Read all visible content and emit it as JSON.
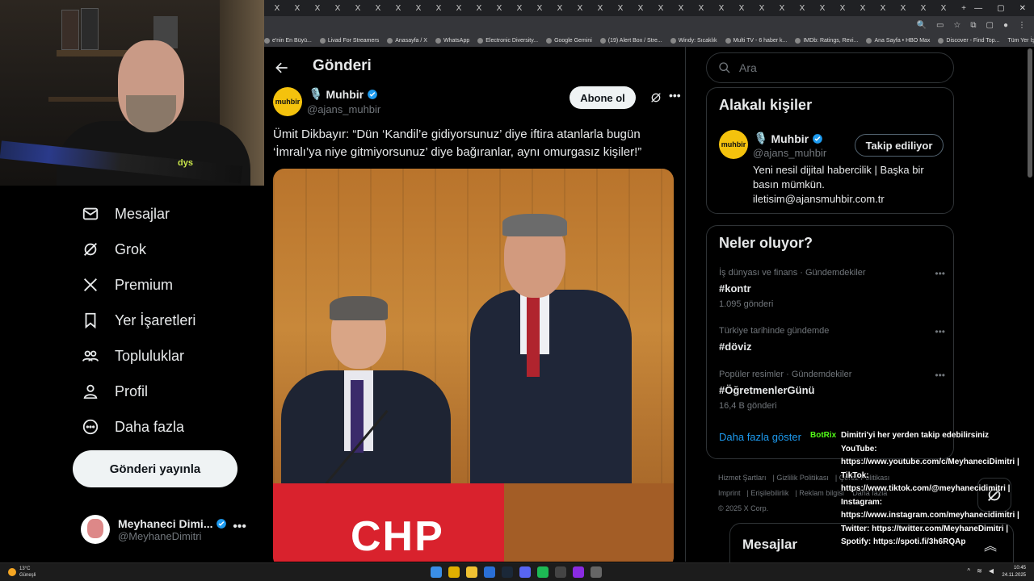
{
  "browser": {
    "tab_glyph": "X",
    "tab_count": 34,
    "new_tab": "+",
    "bookmarks": [
      "e'nin En Büyü...",
      "Livad For Streamers",
      "Anasayfa / X",
      "WhatsApp",
      "Electronic Diversity...",
      "Google Gemini",
      "(19) Alert Box / Stre...",
      "Windy: Sıcaklık",
      "Multi TV - 6 haber k...",
      "IMDb: Ratings, Revi...",
      "Ana Sayfa • HBO Max",
      "Discover - Find Top..."
    ],
    "all_bookmarks": "Tüm Yer İşaretleri"
  },
  "nav": {
    "items": [
      {
        "label": "Mesajlar",
        "icon": "mail-icon"
      },
      {
        "label": "Grok",
        "icon": "grok-icon"
      },
      {
        "label": "Premium",
        "icon": "x-logo-icon"
      },
      {
        "label": "Yer İşaretleri",
        "icon": "bookmark-icon"
      },
      {
        "label": "Topluluklar",
        "icon": "communities-icon"
      },
      {
        "label": "Profil",
        "icon": "profile-icon"
      },
      {
        "label": "Daha fazla",
        "icon": "more-circle-icon"
      }
    ],
    "post_button": "Gönderi yayınla",
    "account_name": "Meyhaneci Dimi...",
    "account_handle": "@MeyhaneDimitri"
  },
  "main": {
    "title": "Gönderi",
    "post": {
      "author": "Muhbir",
      "handle": "@ajans_muhbir",
      "avatar_text": "muhbir",
      "subscribe_label": "Abone ol",
      "text": "Ümit Dikbayır: “Dün ‘Kandil’e gidiyorsunuz’ diye iftira atanlarla bugün ‘İmralı’ya niye gitmiyorsunuz’ diye bağıranlar, aynı omurgasız kişiler!”",
      "image_sign": "CHP"
    }
  },
  "right": {
    "search_placeholder": "Ara",
    "related": {
      "title": "Alakalı kişiler",
      "name": "Muhbir",
      "handle": "@ajans_muhbir",
      "avatar_text": "muhbir",
      "follow_label": "Takip ediliyor",
      "bio": "Yeni nesil dijital habercilik | Başka bir basın mümkün. iletisim@ajansmuhbir.com.tr"
    },
    "trends": {
      "title": "Neler oluyor?",
      "items": [
        {
          "context": "İş dünyası ve finans · Gündemdekiler",
          "tag": "#kontr",
          "count": "1.095 gönderi"
        },
        {
          "context": "Türkiye tarihinde gündemde",
          "tag": "#döviz",
          "count": ""
        },
        {
          "context": "Popüler resimler · Gündemdekiler",
          "tag": "#ÖğretmenlerGünü",
          "count": "16,4 B gönderi"
        }
      ],
      "show_more": "Daha fazla göster"
    },
    "footer": {
      "links": [
        "Hizmet Şartları",
        "Gizlilik Politikası",
        "Çerez Politikası",
        "Imprint",
        "Erişilebilirlik",
        "Reklam bilgisi",
        "Daha fazla"
      ],
      "copyright": "© 2025 X Corp."
    },
    "messages_drawer": "Mesajlar"
  },
  "overlay": {
    "bot_name": "BotRix",
    "lines": [
      "Dimitri'yi her yerden takip edebilirsiniz",
      "YouTube:",
      "https://www.youtube.com/c/MeyhaneciDimitri |",
      "TikTok:",
      "https://www.tiktok.com/@meyhanecidimitri |",
      "Instagram:",
      "https://www.instagram.com/meyhanecidimitri |",
      "Twitter: https://twitter.com/MeyhaneDimitri |",
      "Spotify: https://spoti.fi/3h6RQAp"
    ],
    "shirt_text": "dys"
  },
  "taskbar": {
    "temperature": "13°C",
    "weather": "Güneşli",
    "time": "10:45",
    "date": "24.11.2025"
  },
  "colors": {
    "accent": "#1d9bf0",
    "verified": "#1d9bf0",
    "botrix": "#53fc18"
  }
}
